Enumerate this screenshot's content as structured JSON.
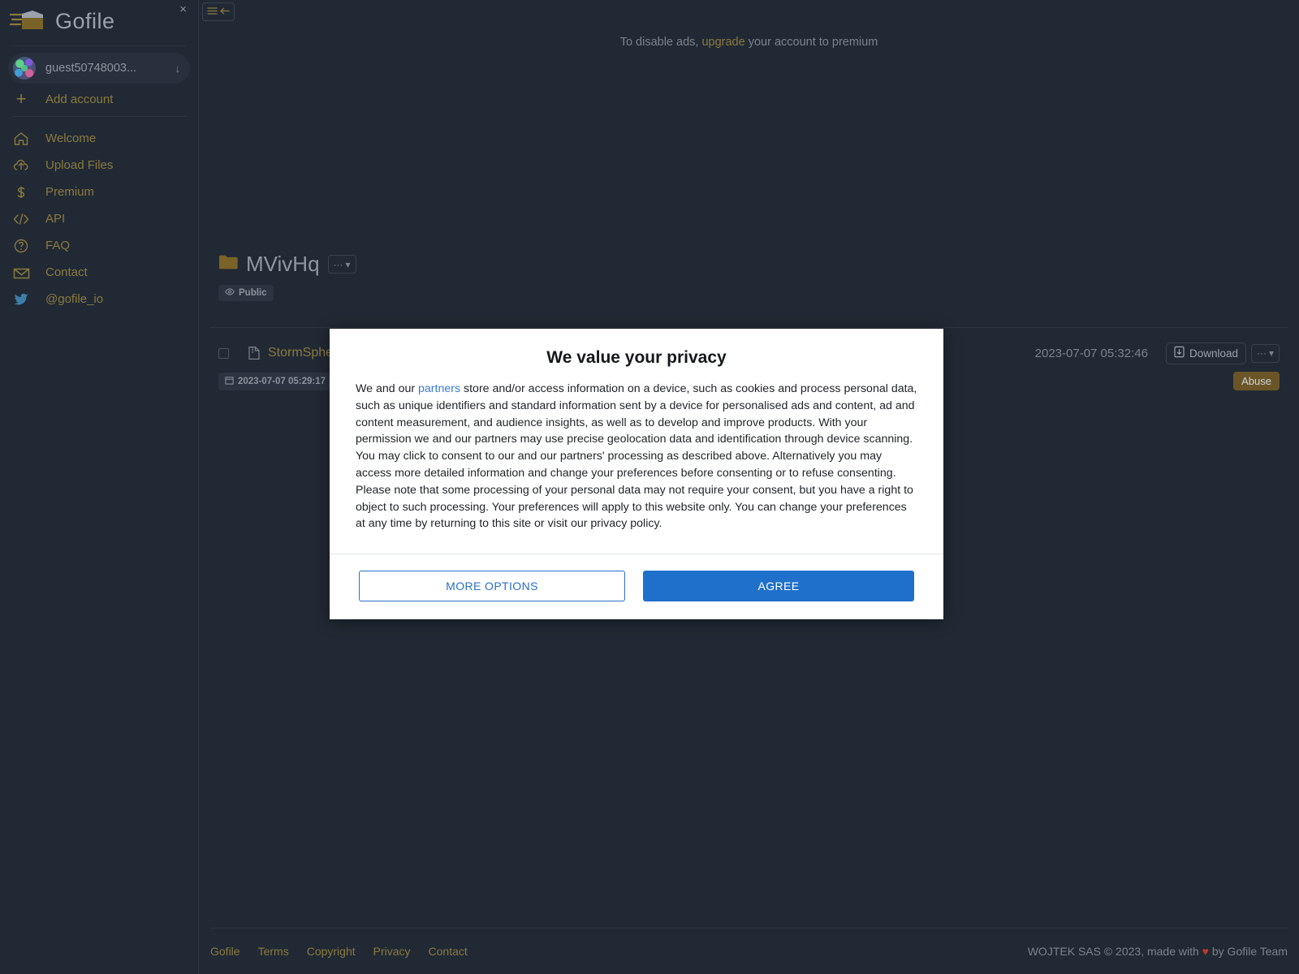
{
  "sidebar": {
    "brand": "Gofile",
    "close_label": "×",
    "account": {
      "name": "guest50748003...",
      "caret": "↓"
    },
    "add_account_label": "Add account",
    "add_plus": "+",
    "items": [
      {
        "label": "Welcome",
        "icon": "home-icon"
      },
      {
        "label": "Upload Files",
        "icon": "upload-cloud-icon"
      },
      {
        "label": "Premium",
        "icon": "dollar-icon"
      },
      {
        "label": "API",
        "icon": "code-icon"
      },
      {
        "label": "FAQ",
        "icon": "question-circle-icon"
      },
      {
        "label": "Contact",
        "icon": "envelope-icon"
      },
      {
        "label": "@gofile_io",
        "icon": "twitter-icon"
      }
    ]
  },
  "topbar": {
    "ad_prefix": "To disable ads,",
    "ad_link": "upgrade",
    "ad_suffix": "your account to premium"
  },
  "folder": {
    "name": "MVivHq",
    "menu_label": "···",
    "visibility_badge": "Public"
  },
  "file": {
    "name": "StormSphe",
    "created": "2023-07-07 05:29:17",
    "modified": "2023-07-07 05:32:46",
    "download_label": "Download",
    "menu_label": "···",
    "abuse_label": "Abuse"
  },
  "footer": {
    "links": [
      "Gofile",
      "Terms",
      "Copyright",
      "Privacy",
      "Contact"
    ],
    "copyright_prefix": "WOJTEK SAS © 2023, made with",
    "heart": "♥",
    "copyright_suffix": "by Gofile Team"
  },
  "dialog": {
    "title": "We value your privacy",
    "text_before_link": "We and our ",
    "link": "partners",
    "text_after_link": " store and/or access information on a device, such as cookies and process personal data, such as unique identifiers and standard information sent by a device for personalised ads and content, ad and content measurement, and audience insights, as well as to develop and improve products. With your permission we and our partners may use precise geolocation data and identification through device scanning. You may click to consent to our and our partners' processing as described above. Alternatively you may access more detailed information and change your preferences before consenting or to refuse consenting. Please note that some processing of your personal data may not require your consent, but you have a right to object to such processing. Your preferences will apply to this website only. You can change your preferences at any time by returning to this site or visit our privacy policy.",
    "more_options_label": "MORE OPTIONS",
    "agree_label": "AGREE"
  },
  "colors": {
    "background": "#212934",
    "accent_gold": "#8a7a3e",
    "panel": "#27303c",
    "border": "#2c3543",
    "primary_blue": "#1f70cb",
    "abuse": "#6b5527"
  }
}
